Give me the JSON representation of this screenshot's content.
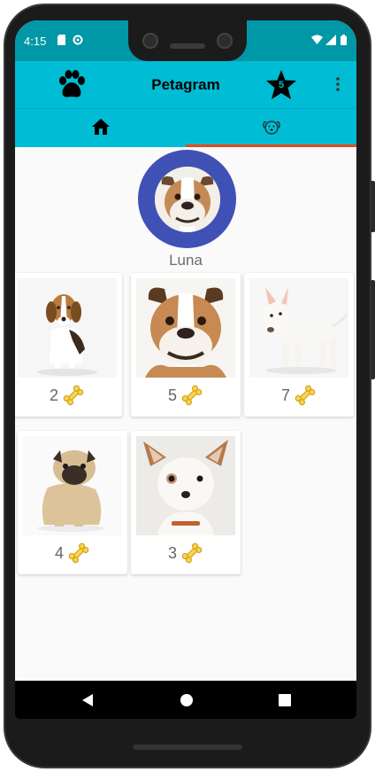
{
  "status_bar": {
    "time": "4:15",
    "icons": [
      "sd-card-icon",
      "sync-icon",
      "wifi-icon",
      "signal-icon",
      "battery-icon"
    ]
  },
  "app_bar": {
    "title": "Petagram",
    "left_icon": "paw-icon",
    "rating_badge_count": "5",
    "colors": {
      "primary": "#00bcd4",
      "primary_dark": "#0097a7",
      "accent": "#e64a19"
    }
  },
  "tabs": [
    {
      "name": "tab-home",
      "icon": "home-icon",
      "selected": false
    },
    {
      "name": "tab-profile",
      "icon": "dog-face-icon",
      "selected": true
    }
  ],
  "profile": {
    "name": "Luna",
    "ring_color": "#3f51b5"
  },
  "pets": [
    {
      "breed": "beagle",
      "likes": "2"
    },
    {
      "breed": "bulldog",
      "likes": "5"
    },
    {
      "breed": "bull-terrier",
      "likes": "7"
    },
    {
      "breed": "pug",
      "likes": "4"
    },
    {
      "breed": "chihuahua",
      "likes": "3"
    }
  ],
  "nav_bar": {
    "buttons": [
      "back-icon",
      "home-circle-icon",
      "recents-icon"
    ]
  }
}
